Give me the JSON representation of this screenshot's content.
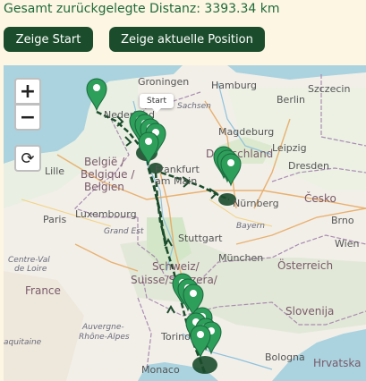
{
  "distance_label": "Gesamt zurückgelegte Distanz: 3393.34 km",
  "buttons": {
    "start": "Zeige Start",
    "current": "Zeige aktuelle Position"
  },
  "map": {
    "zoom_in": "+",
    "zoom_out": "−",
    "reset": "⟳",
    "tooltip": "Start",
    "route_color": "#1b4d2c",
    "marker_color": "#2e9e5b",
    "places": {
      "groningen": "Groningen",
      "hamburg": "Hamburg",
      "szczecin": "Szczecin",
      "nederland": "Nederland",
      "berlin": "Berlin",
      "magdeburg": "Magdeburg",
      "deutschland": "Deutschland",
      "leipzig": "Leipzig",
      "dresden": "Dresden",
      "lille": "Lille",
      "belgie": "België /",
      "belgique": "Belgique /",
      "belgien": "Belgien",
      "frankfurt": "Frankfurt",
      "am_main": "am Main",
      "nurnberg": "Nürnberg",
      "cesko": "Česko",
      "luxembourg": "Luxembourg",
      "brno": "Brno",
      "paris": "Paris",
      "grand_est": "Grand Est",
      "stuttgart": "Stuttgart",
      "bayern": "Bayern",
      "munchen": "München",
      "wien": "Wien",
      "osterreich": "Österreich",
      "centre": "Centre-Val",
      "de_loire": "de Loire",
      "france": "France",
      "schweiz": "Schweiz/",
      "suisse": "Suisse/Svizzera/",
      "slovenija": "Slovenija",
      "auvergne": "Auvergne-",
      "rhone": "Rhône-Alpes",
      "aquitaine": "aquitaine",
      "torino": "Torino",
      "bologna": "Bologna",
      "hrvatska": "Hrvatska",
      "monaco": "Monaco",
      "sachsen": "Sachsen"
    }
  }
}
